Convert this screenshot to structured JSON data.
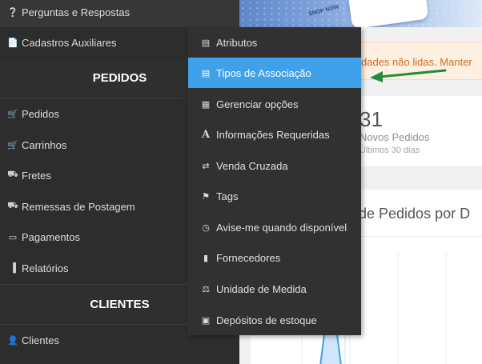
{
  "main": {
    "banner_text": "SNOP NOW",
    "alert_text": "dades não lidas. Manter",
    "stat": {
      "value": "31",
      "label": "Novos Pedidos",
      "period": "Últimos 30 dias"
    },
    "chart_title": "de Pedidos por D"
  },
  "sidebar": {
    "top_items": [
      {
        "icon": "question-circle-icon",
        "label": "Perguntas e Respostas"
      },
      {
        "icon": "file-icon",
        "label": "Cadastros Auxiliares"
      }
    ],
    "section_pedidos": "PEDIDOS",
    "pedidos_items": [
      {
        "icon": "cart-icon",
        "label": "Pedidos"
      },
      {
        "icon": "shopping-cart-icon",
        "label": "Carrinhos"
      },
      {
        "icon": "truck-icon",
        "label": "Fretes"
      },
      {
        "icon": "truck-icon",
        "label": "Remessas de Postagem"
      },
      {
        "icon": "credit-card-icon",
        "label": "Pagamentos"
      },
      {
        "icon": "bar-chart-icon",
        "label": "Relatórios"
      }
    ],
    "section_clientes": "CLIENTES",
    "clientes_items": [
      {
        "icon": "user-icon",
        "label": "Clientes"
      }
    ]
  },
  "flyout": {
    "items": [
      {
        "icon": "list-icon",
        "label": "Atributos"
      },
      {
        "icon": "tasks-icon",
        "label": "Tipos de Associação",
        "active": true
      },
      {
        "icon": "grid-icon",
        "label": "Gerenciar opções"
      },
      {
        "icon": "font-icon",
        "label": "Informações Requeridas"
      },
      {
        "icon": "shuffle-icon",
        "label": "Venda Cruzada"
      },
      {
        "icon": "tag-icon",
        "label": "Tags"
      },
      {
        "icon": "clock-icon",
        "label": "Avise-me quando disponível"
      },
      {
        "icon": "industry-icon",
        "label": "Fornecedores"
      },
      {
        "icon": "balance-scale-icon",
        "label": "Unidade de Medida"
      },
      {
        "icon": "archive-icon",
        "label": "Depósitos de estoque"
      }
    ]
  },
  "colors": {
    "sidebar": "#2d2d2d",
    "active": "#3ea1ea",
    "alert": "#d06b1f",
    "arrow": "#1e8e3e"
  }
}
